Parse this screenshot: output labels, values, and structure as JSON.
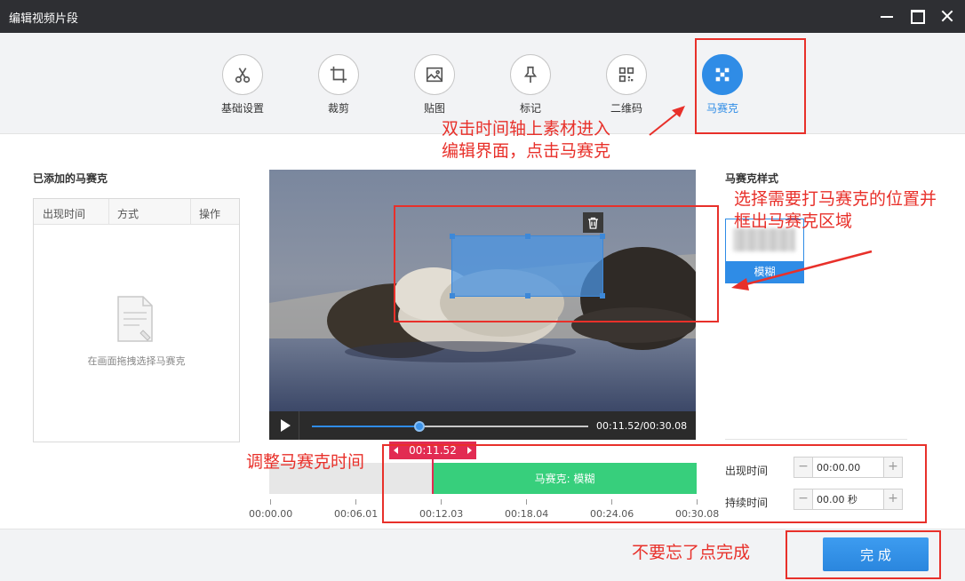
{
  "window": {
    "title": "编辑视频片段"
  },
  "toolbar": {
    "items": [
      {
        "label": "基础设置",
        "icon": "scissors-icon"
      },
      {
        "label": "裁剪",
        "icon": "crop-icon"
      },
      {
        "label": "贴图",
        "icon": "image-icon"
      },
      {
        "label": "标记",
        "icon": "pin-icon"
      },
      {
        "label": "二维码",
        "icon": "qrcode-icon"
      },
      {
        "label": "马赛克",
        "icon": "mosaic-icon",
        "active": true
      }
    ]
  },
  "left_panel": {
    "title": "已添加的马赛克",
    "columns": [
      "出现时间",
      "方式",
      "操作"
    ],
    "empty_text": "在画面拖拽选择马赛克"
  },
  "player": {
    "time_display": "00:11.52/00:30.08",
    "progress": 0.39
  },
  "timeline": {
    "playhead_label": "00:11.52",
    "segment_label": "马赛克: 模糊",
    "ruler": [
      "00:00.00",
      "00:06.01",
      "00:12.03",
      "00:18.04",
      "00:24.06",
      "00:30.08"
    ]
  },
  "right_panel": {
    "title": "马赛克样式",
    "style_option": "模糊",
    "appear_label": "出现时间",
    "appear_value": "00:00.00",
    "duration_label": "持续时间",
    "duration_value": "00.00 秒"
  },
  "footer": {
    "done_label": "完 成"
  },
  "annotations": {
    "click_mosaic": [
      "双击时间轴上素材进入",
      "编辑界面，点击马赛克"
    ],
    "select_area": [
      "选择需要打马赛克的位置并",
      "框出马赛克区域"
    ],
    "adjust_time": "调整马赛克时间",
    "remember_done": "不要忘了点完成"
  },
  "colors": {
    "accent": "#2f8ce6",
    "segment": "#37cf7c",
    "playhead": "#e22b52",
    "annotation": "#e8302a"
  }
}
